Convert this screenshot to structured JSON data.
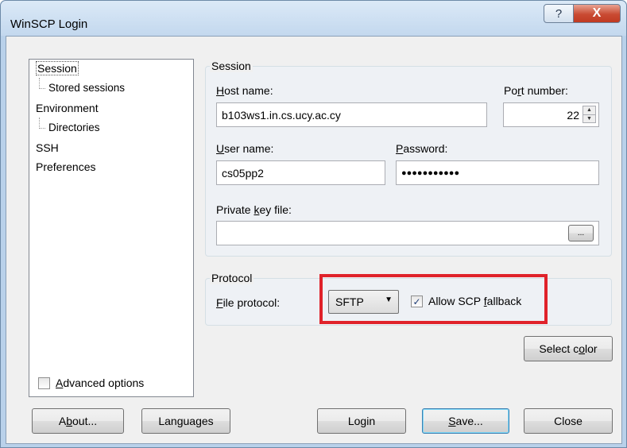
{
  "window": {
    "title": "WinSCP Login",
    "help_label": "?",
    "close_label": "X"
  },
  "tree": {
    "items": [
      {
        "label": "Session"
      },
      {
        "label": "Stored sessions"
      },
      {
        "label": "Environment"
      },
      {
        "label": "Directories"
      },
      {
        "label": "SSH"
      },
      {
        "label": "Preferences"
      }
    ]
  },
  "session": {
    "group_label": "Session",
    "host_label_u": "H",
    "host_label_rest": "ost name:",
    "host_value": "b103ws1.in.cs.ucy.ac.cy",
    "port_label_a": "Po",
    "port_label_u": "r",
    "port_label_b": "t number:",
    "port_value": "22",
    "user_label_u": "U",
    "user_label_rest": "ser name:",
    "user_value": "cs05pp2",
    "password_label_u": "P",
    "password_label_rest": "assword:",
    "password_value": "●●●●●●●●●●●",
    "key_label_a": "Private ",
    "key_label_u": "k",
    "key_label_b": "ey file:",
    "key_value": "",
    "browse_label": "..."
  },
  "protocol": {
    "group_label": "Protocol",
    "file_protocol_label_u": "F",
    "file_protocol_label_rest": "ile protocol:",
    "file_protocol_value": "SFTP",
    "allow_scp_label_a": "Allow SCP ",
    "allow_scp_label_u": "f",
    "allow_scp_label_b": "allback",
    "allow_scp_checked": true
  },
  "select_color": {
    "label_a": "Select c",
    "label_u": "o",
    "label_b": "lor"
  },
  "advanced": {
    "label_u": "A",
    "label_rest": "dvanced options",
    "checked": false
  },
  "buttons": {
    "about_a": "A",
    "about_u": "b",
    "about_b": "out...",
    "languages_a": "Lan",
    "languages_u": "g",
    "languages_b": "uages",
    "login": "Login",
    "save_u": "S",
    "save_rest": "ave...",
    "close": "Close"
  },
  "colors": {
    "highlight": "#e0222a",
    "checkbox_mark": "#1e3c76"
  }
}
